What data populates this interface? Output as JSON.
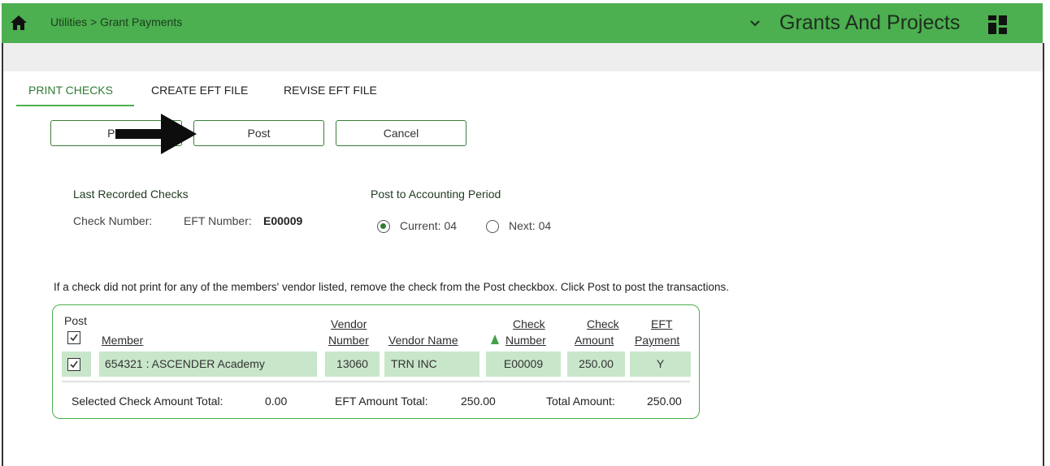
{
  "header": {
    "breadcrumb": "Utilities > Grant Payments",
    "module_title": "Grants And Projects",
    "icons": [
      "home-icon",
      "chevron-down-icon",
      "grid-icon"
    ],
    "bar_color": "#4caf50"
  },
  "tabs": [
    {
      "label": "PRINT CHECKS",
      "active": true
    },
    {
      "label": "CREATE EFT FILE",
      "active": false
    },
    {
      "label": "REVISE EFT FILE",
      "active": false
    }
  ],
  "buttons": {
    "preview": "Pre",
    "post": "Post",
    "cancel": "Cancel"
  },
  "last_recorded": {
    "heading": "Last Recorded Checks",
    "check_label": "Check Number:",
    "check_value": "",
    "eft_label": "EFT Number:",
    "eft_value": "E00009"
  },
  "accounting_period": {
    "heading": "Post to Accounting Period",
    "options": [
      {
        "label": "Current: 04",
        "selected": true
      },
      {
        "label": "Next: 04",
        "selected": false
      }
    ]
  },
  "instruction": "If a check did not print for any of the members' vendor listed, remove the check from the Post checkbox. Click Post to post the transactions.",
  "table": {
    "headers": {
      "post": "Post",
      "member": "Member",
      "vendor_number_1": "Vendor",
      "vendor_number_2": "Number",
      "vendor_name": "Vendor Name",
      "check_number_1": "Check",
      "check_number_2": "Number",
      "check_amount_1": "Check",
      "check_amount_2": "Amount",
      "eft_payment_1": "EFT",
      "eft_payment_2": "Payment"
    },
    "select_all_checked": true,
    "rows": [
      {
        "checked": true,
        "member": "654321 : ASCENDER Academy",
        "vendor_number": "13060",
        "vendor_name": "TRN INC",
        "check_number": "E00009",
        "check_amount": "250.00",
        "eft_payment": "Y"
      }
    ],
    "totals": {
      "selected_label": "Selected Check Amount Total:",
      "selected_value": "0.00",
      "eft_label": "EFT Amount Total:",
      "eft_value": "250.00",
      "total_label": "Total Amount:",
      "total_value": "250.00"
    }
  }
}
